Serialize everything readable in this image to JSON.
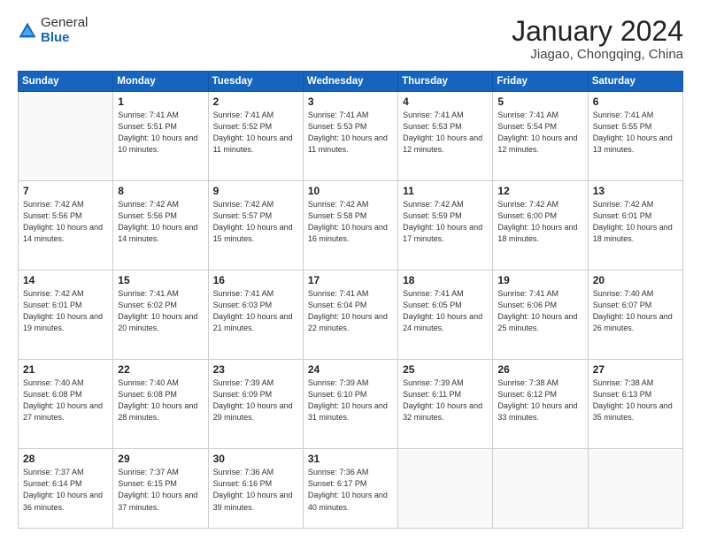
{
  "logo": {
    "general": "General",
    "blue": "Blue"
  },
  "header": {
    "month": "January 2024",
    "location": "Jiagao, Chongqing, China"
  },
  "weekdays": [
    "Sunday",
    "Monday",
    "Tuesday",
    "Wednesday",
    "Thursday",
    "Friday",
    "Saturday"
  ],
  "rows": [
    [
      {
        "day": "",
        "sunrise": "",
        "sunset": "",
        "daylight": ""
      },
      {
        "day": "1",
        "sunrise": "Sunrise: 7:41 AM",
        "sunset": "Sunset: 5:51 PM",
        "daylight": "Daylight: 10 hours and 10 minutes."
      },
      {
        "day": "2",
        "sunrise": "Sunrise: 7:41 AM",
        "sunset": "Sunset: 5:52 PM",
        "daylight": "Daylight: 10 hours and 11 minutes."
      },
      {
        "day": "3",
        "sunrise": "Sunrise: 7:41 AM",
        "sunset": "Sunset: 5:53 PM",
        "daylight": "Daylight: 10 hours and 11 minutes."
      },
      {
        "day": "4",
        "sunrise": "Sunrise: 7:41 AM",
        "sunset": "Sunset: 5:53 PM",
        "daylight": "Daylight: 10 hours and 12 minutes."
      },
      {
        "day": "5",
        "sunrise": "Sunrise: 7:41 AM",
        "sunset": "Sunset: 5:54 PM",
        "daylight": "Daylight: 10 hours and 12 minutes."
      },
      {
        "day": "6",
        "sunrise": "Sunrise: 7:41 AM",
        "sunset": "Sunset: 5:55 PM",
        "daylight": "Daylight: 10 hours and 13 minutes."
      }
    ],
    [
      {
        "day": "7",
        "sunrise": "Sunrise: 7:42 AM",
        "sunset": "Sunset: 5:56 PM",
        "daylight": "Daylight: 10 hours and 14 minutes."
      },
      {
        "day": "8",
        "sunrise": "Sunrise: 7:42 AM",
        "sunset": "Sunset: 5:56 PM",
        "daylight": "Daylight: 10 hours and 14 minutes."
      },
      {
        "day": "9",
        "sunrise": "Sunrise: 7:42 AM",
        "sunset": "Sunset: 5:57 PM",
        "daylight": "Daylight: 10 hours and 15 minutes."
      },
      {
        "day": "10",
        "sunrise": "Sunrise: 7:42 AM",
        "sunset": "Sunset: 5:58 PM",
        "daylight": "Daylight: 10 hours and 16 minutes."
      },
      {
        "day": "11",
        "sunrise": "Sunrise: 7:42 AM",
        "sunset": "Sunset: 5:59 PM",
        "daylight": "Daylight: 10 hours and 17 minutes."
      },
      {
        "day": "12",
        "sunrise": "Sunrise: 7:42 AM",
        "sunset": "Sunset: 6:00 PM",
        "daylight": "Daylight: 10 hours and 18 minutes."
      },
      {
        "day": "13",
        "sunrise": "Sunrise: 7:42 AM",
        "sunset": "Sunset: 6:01 PM",
        "daylight": "Daylight: 10 hours and 18 minutes."
      }
    ],
    [
      {
        "day": "14",
        "sunrise": "Sunrise: 7:42 AM",
        "sunset": "Sunset: 6:01 PM",
        "daylight": "Daylight: 10 hours and 19 minutes."
      },
      {
        "day": "15",
        "sunrise": "Sunrise: 7:41 AM",
        "sunset": "Sunset: 6:02 PM",
        "daylight": "Daylight: 10 hours and 20 minutes."
      },
      {
        "day": "16",
        "sunrise": "Sunrise: 7:41 AM",
        "sunset": "Sunset: 6:03 PM",
        "daylight": "Daylight: 10 hours and 21 minutes."
      },
      {
        "day": "17",
        "sunrise": "Sunrise: 7:41 AM",
        "sunset": "Sunset: 6:04 PM",
        "daylight": "Daylight: 10 hours and 22 minutes."
      },
      {
        "day": "18",
        "sunrise": "Sunrise: 7:41 AM",
        "sunset": "Sunset: 6:05 PM",
        "daylight": "Daylight: 10 hours and 24 minutes."
      },
      {
        "day": "19",
        "sunrise": "Sunrise: 7:41 AM",
        "sunset": "Sunset: 6:06 PM",
        "daylight": "Daylight: 10 hours and 25 minutes."
      },
      {
        "day": "20",
        "sunrise": "Sunrise: 7:40 AM",
        "sunset": "Sunset: 6:07 PM",
        "daylight": "Daylight: 10 hours and 26 minutes."
      }
    ],
    [
      {
        "day": "21",
        "sunrise": "Sunrise: 7:40 AM",
        "sunset": "Sunset: 6:08 PM",
        "daylight": "Daylight: 10 hours and 27 minutes."
      },
      {
        "day": "22",
        "sunrise": "Sunrise: 7:40 AM",
        "sunset": "Sunset: 6:08 PM",
        "daylight": "Daylight: 10 hours and 28 minutes."
      },
      {
        "day": "23",
        "sunrise": "Sunrise: 7:39 AM",
        "sunset": "Sunset: 6:09 PM",
        "daylight": "Daylight: 10 hours and 29 minutes."
      },
      {
        "day": "24",
        "sunrise": "Sunrise: 7:39 AM",
        "sunset": "Sunset: 6:10 PM",
        "daylight": "Daylight: 10 hours and 31 minutes."
      },
      {
        "day": "25",
        "sunrise": "Sunrise: 7:39 AM",
        "sunset": "Sunset: 6:11 PM",
        "daylight": "Daylight: 10 hours and 32 minutes."
      },
      {
        "day": "26",
        "sunrise": "Sunrise: 7:38 AM",
        "sunset": "Sunset: 6:12 PM",
        "daylight": "Daylight: 10 hours and 33 minutes."
      },
      {
        "day": "27",
        "sunrise": "Sunrise: 7:38 AM",
        "sunset": "Sunset: 6:13 PM",
        "daylight": "Daylight: 10 hours and 35 minutes."
      }
    ],
    [
      {
        "day": "28",
        "sunrise": "Sunrise: 7:37 AM",
        "sunset": "Sunset: 6:14 PM",
        "daylight": "Daylight: 10 hours and 36 minutes."
      },
      {
        "day": "29",
        "sunrise": "Sunrise: 7:37 AM",
        "sunset": "Sunset: 6:15 PM",
        "daylight": "Daylight: 10 hours and 37 minutes."
      },
      {
        "day": "30",
        "sunrise": "Sunrise: 7:36 AM",
        "sunset": "Sunset: 6:16 PM",
        "daylight": "Daylight: 10 hours and 39 minutes."
      },
      {
        "day": "31",
        "sunrise": "Sunrise: 7:36 AM",
        "sunset": "Sunset: 6:17 PM",
        "daylight": "Daylight: 10 hours and 40 minutes."
      },
      {
        "day": "",
        "sunrise": "",
        "sunset": "",
        "daylight": ""
      },
      {
        "day": "",
        "sunrise": "",
        "sunset": "",
        "daylight": ""
      },
      {
        "day": "",
        "sunrise": "",
        "sunset": "",
        "daylight": ""
      }
    ]
  ]
}
